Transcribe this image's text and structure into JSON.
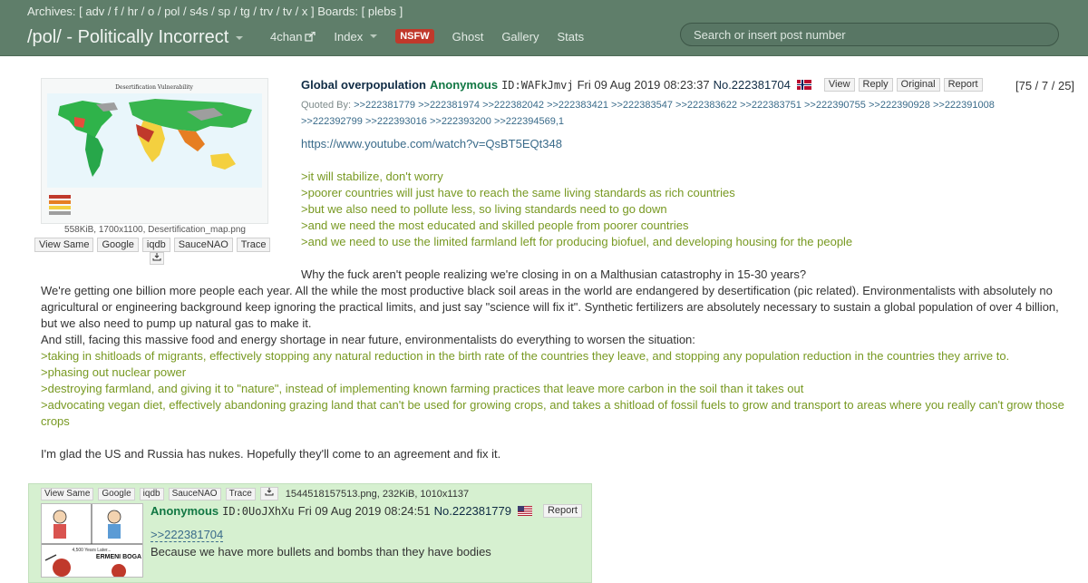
{
  "header": {
    "archives_label": "Archives:",
    "archives": [
      "adv",
      "f",
      "hr",
      "o",
      "pol",
      "s4s",
      "sp",
      "tg",
      "trv",
      "tv",
      "x"
    ],
    "boards_label": "Boards:",
    "boards": [
      "plebs"
    ],
    "board_title": "/pol/ - Politically Incorrect",
    "nav": {
      "fourchan": "4chan",
      "index": "Index",
      "nsfw": "NSFW",
      "ghost": "Ghost",
      "gallery": "Gallery",
      "stats": "Stats"
    },
    "search_placeholder": "Search or insert post number"
  },
  "op": {
    "subject": "Global overpopulation",
    "name": "Anonymous",
    "id": "ID:WAFkJmvj",
    "date": "Fri 09 Aug 2019 08:23:37",
    "post_no": "No.222381704",
    "flag": "Norway",
    "buttons": {
      "view": "View",
      "reply": "Reply",
      "original": "Original",
      "report": "Report"
    },
    "stats": "[75 / 7 / 25]",
    "quoted_by_label": "Quoted By:",
    "quoted_by": [
      ">>222381779",
      ">>222381974",
      ">>222382042",
      ">>222383421",
      ">>222383547",
      ">>222383622",
      ">>222383751",
      ">>222390755",
      ">>222390928",
      ">>222391008",
      ">>222392799",
      ">>222393016",
      ">>222393200",
      ">>222394569,1"
    ],
    "file": {
      "thumb_title": "Desertification Vulnerability",
      "info": "558KiB, 1700x1100, Desertification_map.png",
      "buttons": [
        "View Same",
        "Google",
        "iqdb",
        "SauceNAO",
        "Trace"
      ]
    },
    "link": "https://www.youtube.com/watch?v=QsBT5EQt348",
    "greentext_1": [
      ">it will stabilize, don't worry",
      ">poorer countries will just have to reach the same living standards as rich countries",
      ">but we also need to pollute less, so living standards need to go down",
      ">and we need the most educated and skilled people from poorer countries",
      ">and we need to use the limited farmland left for producing biofuel, and developing housing for the people"
    ],
    "para_1": "Why the fuck aren't people realizing we're closing in on a Malthusian catastrophy in 15-30 years?",
    "para_2": "We're getting one billion more people each year. All the while the most productive black soil areas in the world are endangered by desertification (pic related). Environmentalists with absolutely no agricultural or engineering background keep ignoring the practical limits, and just say \"science will fix it\". Synthetic fertilizers are absolutely necessary to sustain a global population of over 4 billion, but we also need to pump up natural gas to make it.",
    "para_3": "And still, facing this massive food and energy shortage in near future, environmentalists do everything to worsen the situation:",
    "greentext_2": [
      ">taking in shitloads of migrants, effectively stopping any natural reduction in the birth rate of the countries they leave, and stopping any population reduction in the countries they arrive to.",
      ">phasing out nuclear power",
      ">destroying farmland, and giving it to \"nature\", instead of implementing known farming practices that leave more carbon in the soil than it takes out",
      ">advocating vegan diet, effectively abandoning grazing land that can't be used for growing crops, and takes a shitload of fossil fuels to grow and transport to areas where you really can't grow those crops"
    ],
    "para_4": "I'm glad the US and Russia has nukes. Hopefully they'll come to an agreement and fix it."
  },
  "reply": {
    "file_buttons": [
      "View Same",
      "Google",
      "iqdb",
      "SauceNAO",
      "Trace"
    ],
    "file_info": "1544518157513.png, 232KiB, 1010x1137",
    "thumb_caption_1": "4,500 Years Later...",
    "thumb_caption_2": "ERMENI BOGA",
    "name": "Anonymous",
    "id": "ID:0UoJXhXu",
    "date": "Fri 09 Aug 2019 08:24:51",
    "post_no": "No.222381779",
    "flag": "United States",
    "report": "Report",
    "quote": ">>222381704",
    "text": "Because we have more bullets and bombs than they have bodies"
  },
  "colors": {
    "header_bg": "#5f7e6a",
    "reply_bg": "#d6f0d0",
    "greentext": "#789922",
    "name": "#117743",
    "nsfw": "#c0392b"
  }
}
